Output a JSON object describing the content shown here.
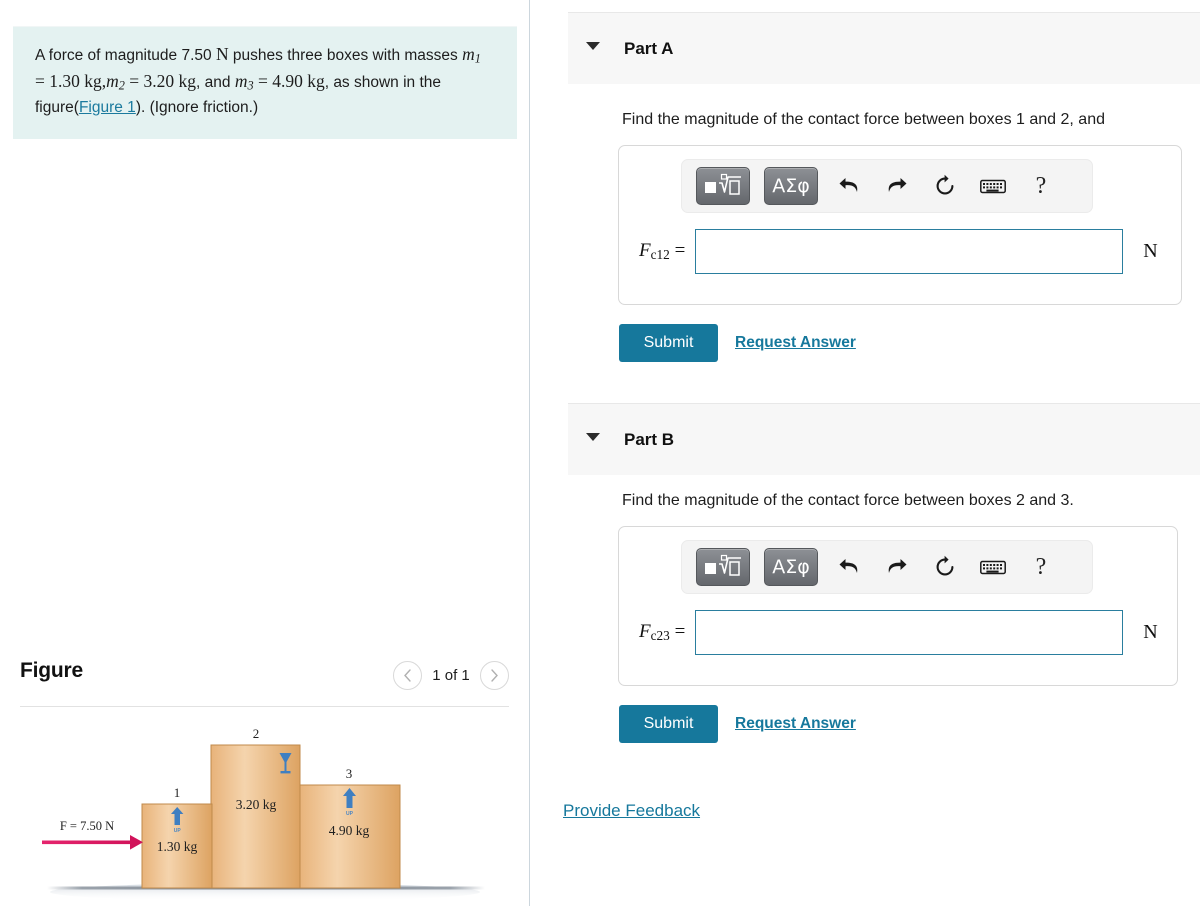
{
  "problem": {
    "text_part1": "A force of magnitude 7.50",
    "unit_N": "N",
    "text_part2": "pushes three boxes with masses",
    "m1_sym": "m",
    "m1_sub": "1",
    "m1_eq": "=",
    "m1_val": "1.30",
    "m1_unit": "kg",
    "comma1": ",",
    "m2_sym": "m",
    "m2_sub": "2",
    "m2_eq": "=",
    "m2_val": "3.20",
    "m2_unit": "kg",
    "text_and": ", and",
    "m3_sym": "m",
    "m3_sub": "3",
    "m3_eq": "=",
    "m3_val": "4.90",
    "m3_unit": "kg",
    "text_part3": ", as shown in the figure(",
    "figure_link": "Figure 1",
    "text_part4": "). (Ignore friction.)"
  },
  "figure": {
    "title": "Figure",
    "counter": "1 of 1",
    "prev_icon": "chevron-left-icon",
    "next_icon": "chevron-right-icon",
    "diagram": {
      "force_label": "F = 7.50 N",
      "force_arrow_color": "#e01a62",
      "ground_color": "#8a9099",
      "box_fill_light": "#f3cfa0",
      "box_fill_dark": "#d89b55",
      "icon_color": "#3f7fc1",
      "boxes": [
        {
          "number": "1",
          "mass": "1.30 kg",
          "icon": "this-side-up-icon",
          "icon_caption": "UP"
        },
        {
          "number": "2",
          "mass": "3.20 kg",
          "icon": "fragile-glass-icon",
          "icon_caption": ""
        },
        {
          "number": "3",
          "mass": "4.90 kg",
          "icon": "this-side-up-icon",
          "icon_caption": "UP"
        }
      ]
    }
  },
  "parts": [
    {
      "id": "part-a",
      "label": "Part A",
      "caret_icon": "caret-down-icon",
      "question": "Find the magnitude of the contact force between boxes 1 and 2, and",
      "answer_symbol_F": "F",
      "answer_symbol_sub": "c12",
      "answer_equals": "=",
      "answer_value": "",
      "answer_placeholder": "",
      "unit": "N",
      "submit_label": "Submit",
      "request_label": "Request Answer"
    },
    {
      "id": "part-b",
      "label": "Part B",
      "caret_icon": "caret-down-icon",
      "question": "Find the magnitude of the contact force between boxes 2 and 3.",
      "answer_symbol_F": "F",
      "answer_symbol_sub": "c23",
      "answer_equals": "=",
      "answer_value": "",
      "answer_placeholder": "",
      "unit": "N",
      "submit_label": "Submit",
      "request_label": "Request Answer"
    }
  ],
  "toolbar": {
    "math_template_label": "math-template-button",
    "greek_label": "ΑΣφ",
    "undo_icon": "undo-arrow-icon",
    "redo_icon": "redo-arrow-icon",
    "reset_icon": "reset-circle-icon",
    "keyboard_icon": "keyboard-icon",
    "help_label": "?"
  },
  "footer": {
    "provide_feedback": "Provide Feedback"
  },
  "colors": {
    "accent": "#16789c",
    "problem_bg": "#e4f2f1",
    "header_bg": "#f7f7f7",
    "input_border": "#2a7e9e"
  }
}
